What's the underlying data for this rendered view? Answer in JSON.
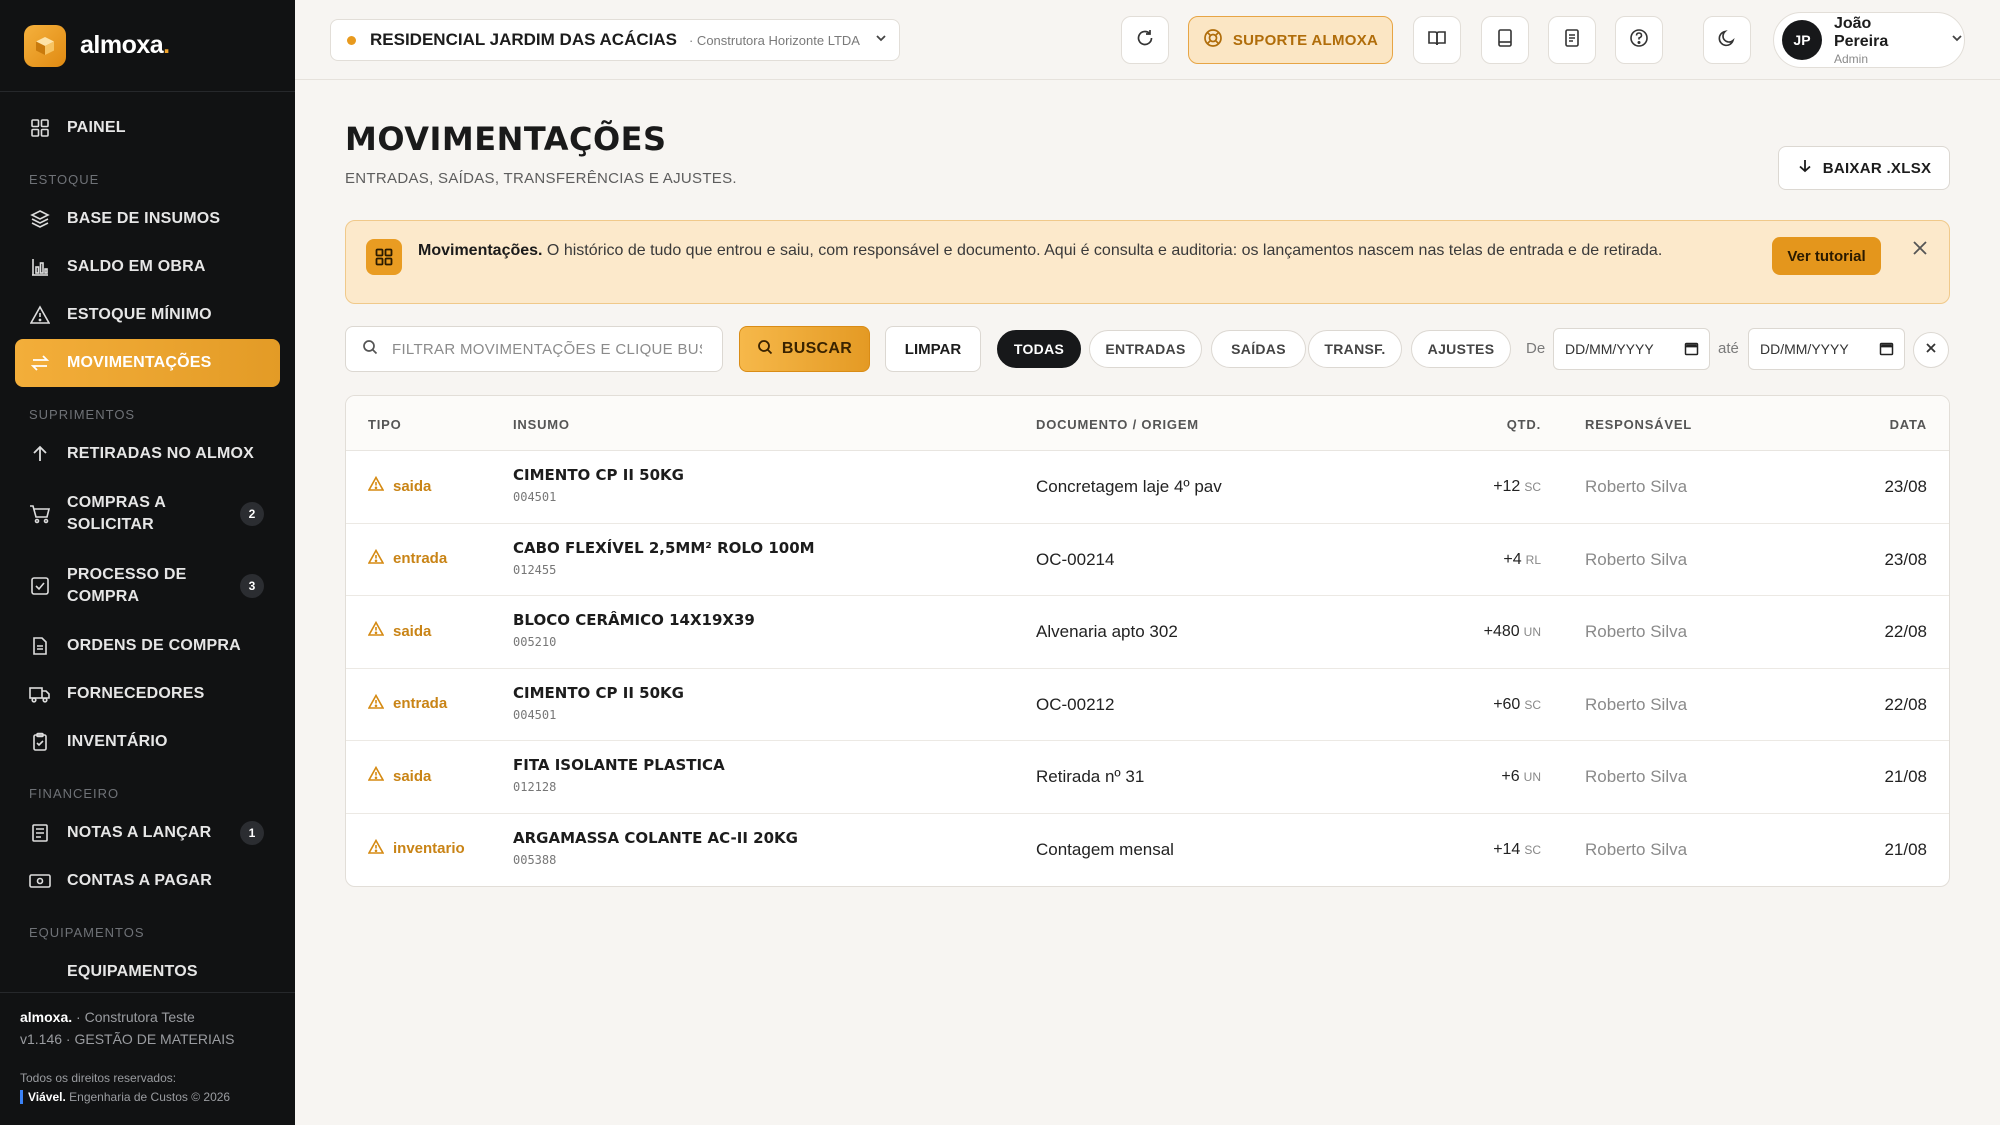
{
  "brand": {
    "name": "almoxa",
    "dot": "."
  },
  "sidebar": {
    "painel": "PAINEL",
    "sections": {
      "estoque": "ESTOQUE",
      "suprimentos": "SUPRIMENTOS",
      "financeiro": "FINANCEIRO",
      "equipamentos": "EQUIPAMENTOS"
    },
    "items": {
      "base_insumos": "BASE DE INSUMOS",
      "saldo_obra": "SALDO EM OBRA",
      "estoque_minimo": "ESTOQUE MÍNIMO",
      "movimentacoes": "MOVIMENTAÇÕES",
      "retiradas": "RETIRADAS NO ALMOX",
      "compras_l1": "COMPRAS A",
      "compras_l2": "SOLICITAR",
      "compras_badge": "2",
      "processo_l1": "PROCESSO DE",
      "processo_l2": "COMPRA",
      "processo_badge": "3",
      "ordens": "ORDENS DE COMPRA",
      "fornecedores": "FORNECEDORES",
      "inventario": "INVENTÁRIO",
      "notas": "NOTAS A LANÇAR",
      "notas_badge": "1",
      "contas": "CONTAS A PAGAR",
      "equipamentos": "EQUIPAMENTOS"
    },
    "footer": {
      "brand": "almoxa.",
      "company": " · Construtora Teste",
      "version": "v1.146 · GESTÃO DE MATERIAIS",
      "rights": "Todos os direitos reservados:",
      "maker": "Viável.",
      "maker_rest": " Engenharia de Custos © 2026"
    }
  },
  "topbar": {
    "project_name": "RESIDENCIAL JARDIM DAS ACÁCIAS",
    "project_company": "· Construtora Horizonte LTDA",
    "support": "SUPORTE ALMOXA",
    "user_initials": "JP",
    "user_name": "João Pereira",
    "user_role": "Admin"
  },
  "page": {
    "title": "MOVIMENTAÇÕES",
    "subtitle": "ENTRADAS, SAÍDAS, TRANSFERÊNCIAS E AJUSTES.",
    "download": "BAIXAR .XLSX"
  },
  "info": {
    "title": "Movimentações.",
    "text": " O histórico de tudo que entrou e saiu, com responsável e documento. Aqui é consulta e auditoria: os lançamentos nascem nas telas de entrada e de retirada.",
    "tutorial": "Ver tutorial"
  },
  "filters": {
    "search_placeholder": "FILTRAR MOVIMENTAÇÕES E CLIQUE BUSCAR",
    "search_btn": "BUSCAR",
    "clear_btn": "LIMPAR",
    "chips": [
      "TODAS",
      "ENTRADAS",
      "SAÍDAS",
      "TRANSF.",
      "AJUSTES"
    ],
    "active_chip": "TODAS",
    "from_label": "De",
    "to_label": "até",
    "date_placeholder": "DD/MM/YYYY"
  },
  "table": {
    "headers": [
      "TIPO",
      "INSUMO",
      "DOCUMENTO / ORIGEM",
      "QTD.",
      "RESPONSÁVEL",
      "DATA"
    ],
    "rows": [
      {
        "tipo": "saida",
        "insumo": "CIMENTO CP II 50KG",
        "codigo": "004501",
        "doc": "Concretagem laje 4º pav",
        "qtd": "+12",
        "unit": "SC",
        "resp": "Roberto Silva",
        "data": "23/08"
      },
      {
        "tipo": "entrada",
        "insumo": "CABO FLEXÍVEL 2,5MM² ROLO 100M",
        "codigo": "012455",
        "doc": "OC-00214",
        "qtd": "+4",
        "unit": "RL",
        "resp": "Roberto Silva",
        "data": "23/08"
      },
      {
        "tipo": "saida",
        "insumo": "BLOCO CERÂMICO 14X19X39",
        "codigo": "005210",
        "doc": "Alvenaria apto 302",
        "qtd": "+480",
        "unit": "UN",
        "resp": "Roberto Silva",
        "data": "22/08"
      },
      {
        "tipo": "entrada",
        "insumo": "CIMENTO CP II 50KG",
        "codigo": "004501",
        "doc": "OC-00212",
        "qtd": "+60",
        "unit": "SC",
        "resp": "Roberto Silva",
        "data": "22/08"
      },
      {
        "tipo": "saida",
        "insumo": "FITA ISOLANTE PLASTICA",
        "codigo": "012128",
        "doc": "Retirada nº 31",
        "qtd": "+6",
        "unit": "UN",
        "resp": "Roberto Silva",
        "data": "21/08"
      },
      {
        "tipo": "inventario",
        "insumo": "ARGAMASSA COLANTE AC-II 20KG",
        "codigo": "005388",
        "doc": "Contagem mensal",
        "qtd": "+14",
        "unit": "SC",
        "resp": "Roberto Silva",
        "data": "21/08"
      }
    ]
  },
  "colors": {
    "accent": "#e89a1e",
    "sidebar_bg": "#111213",
    "warning": "#c98416"
  }
}
